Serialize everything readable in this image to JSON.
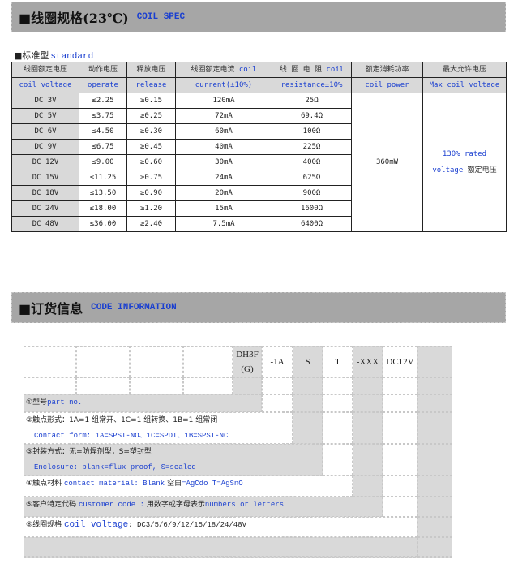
{
  "section1": {
    "title_cn": "■线圈规格(23℃)",
    "title_en": "COIL SPEC",
    "subtitle_cn": "■标准型",
    "subtitle_en": "standard"
  },
  "spec_table": {
    "headers": [
      {
        "cn": "线圈额定电压",
        "en": "coil voltage"
      },
      {
        "cn": "动作电压",
        "en": "operate"
      },
      {
        "cn": "释放电压",
        "en": "release"
      },
      {
        "cn": "线圈额定电流",
        "cn_en": "coil",
        "en": "current(±10%)"
      },
      {
        "cn": "线 圈 电 阻",
        "cn_en": "coil",
        "en": "resistance±10%"
      },
      {
        "cn": "额定消耗功率",
        "en": "coil power"
      },
      {
        "cn": "最大允许电压",
        "en": "Max coil voltage"
      }
    ],
    "rows": [
      {
        "voltage": "DC  3V",
        "operate": "≤2.25",
        "release": "≥0.15",
        "current": "120mA",
        "resistance": "25Ω"
      },
      {
        "voltage": "DC  5V",
        "operate": "≤3.75",
        "release": "≥0.25",
        "current": "72mA",
        "resistance": "69.4Ω"
      },
      {
        "voltage": "DC  6V",
        "operate": "≤4.50",
        "release": "≥0.30",
        "current": "60mA",
        "resistance": "100Ω"
      },
      {
        "voltage": "DC  9V",
        "operate": "≤6.75",
        "release": "≥0.45",
        "current": "40mA",
        "resistance": "225Ω"
      },
      {
        "voltage": "DC 12V",
        "operate": "≤9.00",
        "release": "≥0.60",
        "current": "30mA",
        "resistance": "400Ω"
      },
      {
        "voltage": "DC 15V",
        "operate": "≤11.25",
        "release": "≥0.75",
        "current": "24mA",
        "resistance": "625Ω"
      },
      {
        "voltage": "DC 18V",
        "operate": "≤13.50",
        "release": "≥0.90",
        "current": "20mA",
        "resistance": "900Ω"
      },
      {
        "voltage": "DC 24V",
        "operate": "≤18.00",
        "release": "≥1.20",
        "current": "15mA",
        "resistance": "1600Ω"
      },
      {
        "voltage": "DC 48V",
        "operate": "≤36.00",
        "release": "≥2.40",
        "current": "7.5mA",
        "resistance": "6400Ω"
      }
    ],
    "coil_power": "360mW",
    "max_voltage_en1": "130% rated",
    "max_voltage_en2": "voltage",
    "max_voltage_cn": "额定电压"
  },
  "section2": {
    "title_cn": "■订货信息",
    "title_en": "CODE INFORMATION"
  },
  "code": {
    "parts": [
      "DH3F",
      "(G)",
      "-1A",
      "S",
      "T",
      "-XXX",
      "DC12V"
    ],
    "items": [
      {
        "num_cn": "①型号",
        "en": "part no."
      },
      {
        "cn": "②触点形式：1A=1 组常开、1C=1 组转换、1B=1 组常闭",
        "en": "Contact form: 1A=SPST-NO、1C=SPDT、1B=SPST-NC"
      },
      {
        "cn": "③封装方式：无=防焊剂型，S=塑封型",
        "en": "Enclosure: blank=flux proof, S=sealed"
      },
      {
        "num_cn": "④触点材料",
        "en": "contact material: Blank",
        "cn2": "空白",
        "en2": "=AgCdo  T=AgSnO"
      },
      {
        "num_cn": "⑤客户特定代码",
        "en": "customer code :",
        "cn2": "用数字或字母表示",
        "en2": "numbers or letters"
      },
      {
        "num_cn": "⑥线圈规格",
        "en": "coil voltage",
        "rest": ": DC3/5/6/9/12/15/18/24/48V"
      }
    ]
  }
}
